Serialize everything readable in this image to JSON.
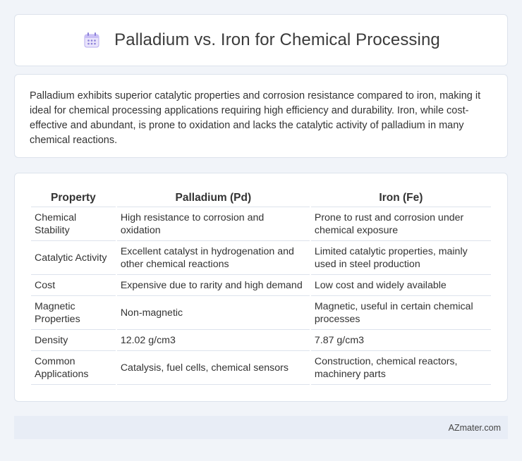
{
  "header": {
    "title": "Palladium vs. Iron for Chemical Processing",
    "icon": "calendar-icon",
    "icon_color": "#8a7fd8"
  },
  "summary": {
    "text": "Palladium exhibits superior catalytic properties and corrosion resistance compared to iron, making it ideal for chemical processing applications requiring high efficiency and durability. Iron, while cost-effective and abundant, is prone to oxidation and lacks the catalytic activity of palladium in many chemical reactions."
  },
  "table": {
    "headers": [
      "Property",
      "Palladium (Pd)",
      "Iron (Fe)"
    ],
    "rows": [
      [
        "Chemical Stability",
        "High resistance to corrosion and oxidation",
        "Prone to rust and corrosion under chemical exposure"
      ],
      [
        "Catalytic Activity",
        "Excellent catalyst in hydrogenation and other chemical reactions",
        "Limited catalytic properties, mainly used in steel production"
      ],
      [
        "Cost",
        "Expensive due to rarity and high demand",
        "Low cost and widely available"
      ],
      [
        "Magnetic Properties",
        "Non-magnetic",
        "Magnetic, useful in certain chemical processes"
      ],
      [
        "Density",
        "12.02 g/cm3",
        "7.87 g/cm3"
      ],
      [
        "Common Applications",
        "Catalysis, fuel cells, chemical sensors",
        "Construction, chemical reactors, machinery parts"
      ]
    ]
  },
  "footer": {
    "text": "AZmater.com"
  }
}
